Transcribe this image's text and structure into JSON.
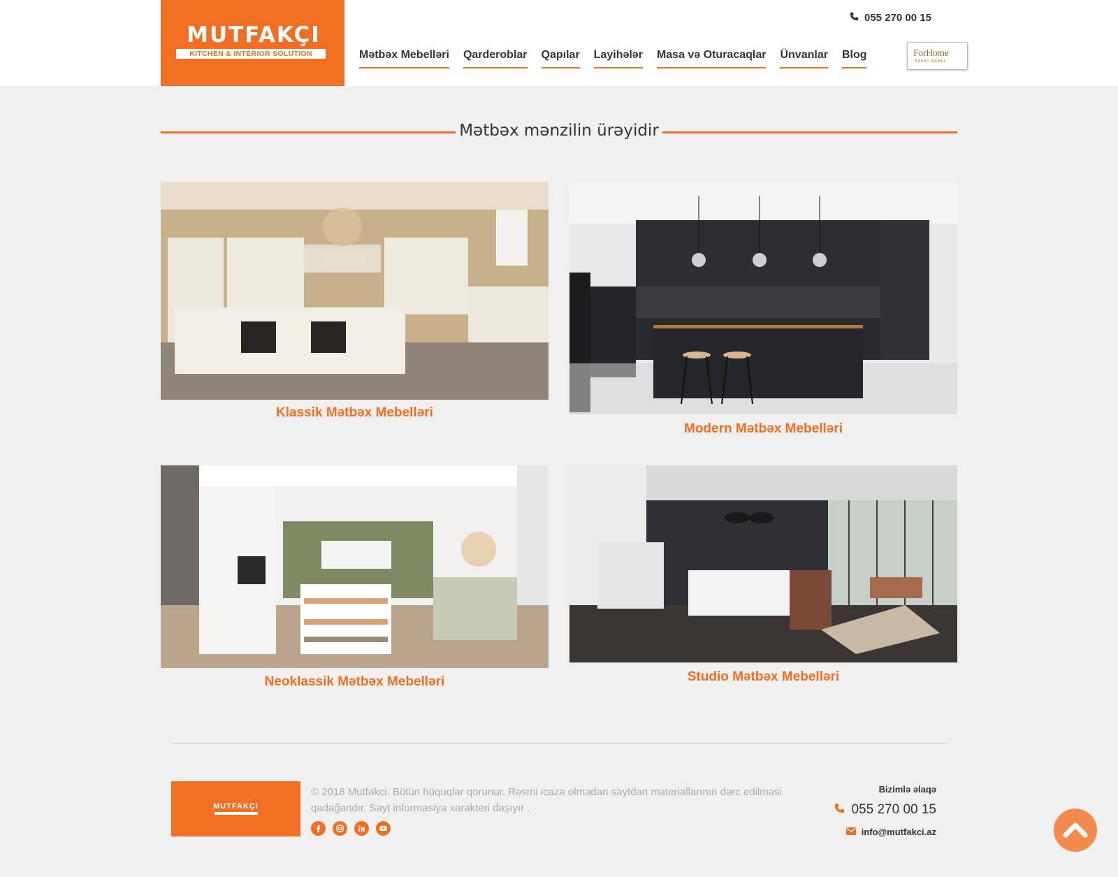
{
  "header": {
    "logo_title": "MUTFAKÇI",
    "logo_subtitle": "KITCHEN & INTERIOR SOLUTION",
    "phone": "055 270 00 15",
    "nav": [
      "Mətbəx Mebelləri",
      "Qarderoblar",
      "Qapılar",
      "Layihələr",
      "Masa və Oturacaqlar",
      "Ünvanlar",
      "Blog"
    ],
    "partner_logo": "ForHome",
    "partner_sub": "RAHAT MEBEL"
  },
  "main": {
    "section_title": "Mətbəx mənzilin ürəyidir",
    "cards": [
      {
        "label": "Klassik Mətbəx Mebelləri"
      },
      {
        "label": "Modern Mətbəx Mebelləri"
      },
      {
        "label": "Neoklassik Mətbəx Mebelləri"
      },
      {
        "label": "Studio Mətbəx Mebelləri"
      }
    ]
  },
  "footer": {
    "logo_title": "MUTFAKÇI",
    "copyright": "© 2018 Mutfakci. Bütün hüquqlar qorunur. Rəsmi icazə olmadan saytdan materiallarının dərc edilməsi qadağandır. Sayt informasiya xarakteri daşıyır .",
    "contact_title": "Bizimlə əlaqə",
    "phone": "055 270 00 15",
    "email": "info@mutfakci.az",
    "socials": [
      "facebook-icon",
      "instagram-icon",
      "linkedin-icon",
      "youtube-icon"
    ]
  },
  "colors": {
    "accent": "#f06f23",
    "background": "#f0f0f0",
    "scroll_button": "#f58a4e"
  }
}
